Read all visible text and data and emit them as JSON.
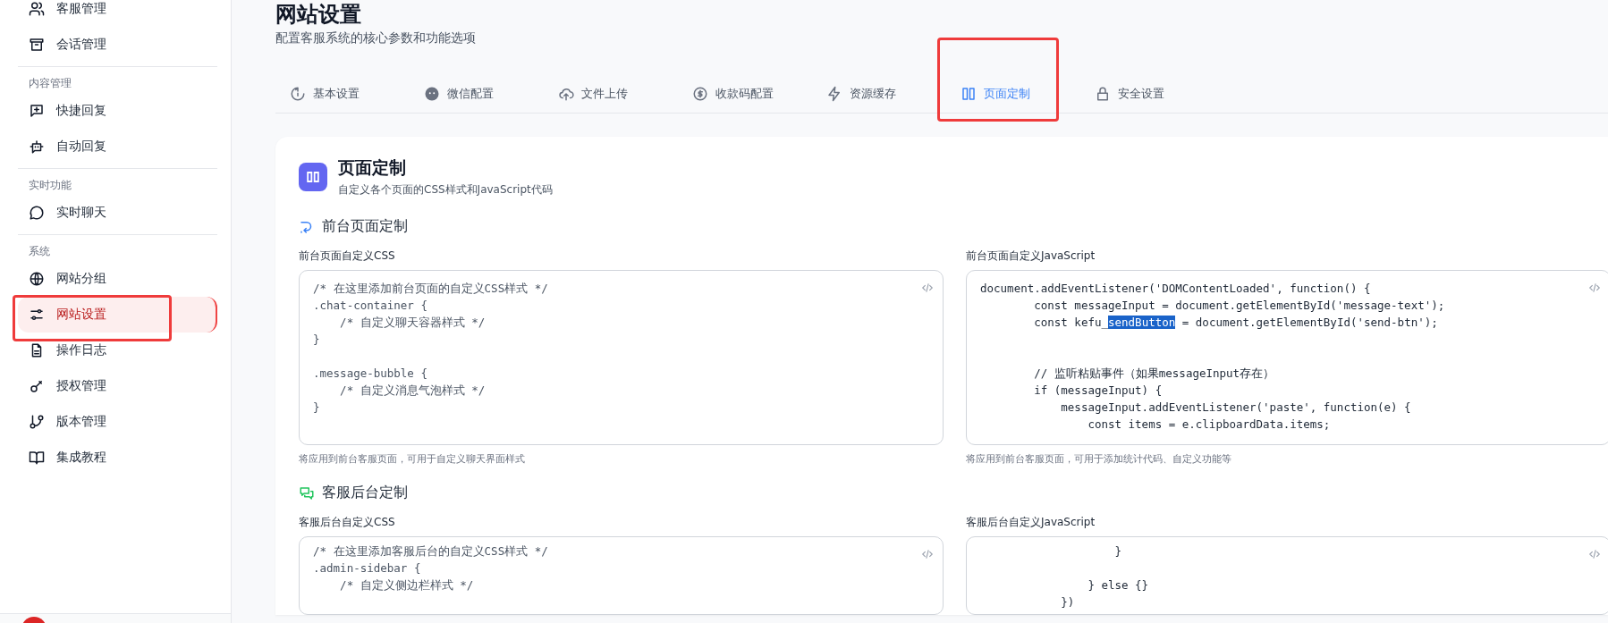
{
  "sidebar": {
    "groups": [
      {
        "items": [
          {
            "label": "客服管理",
            "selected": false
          },
          {
            "label": "会话管理",
            "selected": false
          }
        ]
      },
      {
        "heading": "内容管理",
        "items": [
          {
            "label": "快捷回复",
            "selected": false
          },
          {
            "label": "自动回复",
            "selected": false
          }
        ]
      },
      {
        "heading": "实时功能",
        "items": [
          {
            "label": "实时聊天",
            "selected": false
          }
        ]
      },
      {
        "heading": "系统",
        "items": [
          {
            "label": "网站分组",
            "selected": false
          },
          {
            "label": "网站设置",
            "selected": true
          },
          {
            "label": "操作日志",
            "selected": false
          },
          {
            "label": "授权管理",
            "selected": false
          },
          {
            "label": "版本管理",
            "selected": false
          },
          {
            "label": "集成教程",
            "selected": false
          }
        ]
      }
    ]
  },
  "page": {
    "title": "网站设置",
    "subtitle": "配置客服系统的核心参数和功能选项"
  },
  "tabs": [
    {
      "label": "基本设置",
      "selected": false
    },
    {
      "label": "微信配置",
      "selected": false
    },
    {
      "label": "文件上传",
      "selected": false
    },
    {
      "label": "收款码配置",
      "selected": false
    },
    {
      "label": "资源缓存",
      "selected": false
    },
    {
      "label": "页面定制",
      "selected": true
    },
    {
      "label": "安全设置",
      "selected": false
    }
  ],
  "card": {
    "title": "页面定制",
    "subtitle": "自定义各个页面的CSS样式和JavaScript代码",
    "sections": [
      {
        "heading": "前台页面定制",
        "editors": [
          {
            "label": "前台页面自定义CSS",
            "code": [
              {
                "text": "/* 在这里添加前台页面的自定义CSS样式 */\n.chat-container {\n    /* 自定义聊天容器样式 */\n}\n\n.message-bubble {\n    /* 自定义消息气泡样式 */\n}",
                "selected": false
              }
            ],
            "hint": "将应用到前台客服页面，可用于自定义聊天界面样式"
          },
          {
            "label": "前台页面自定义JavaScript",
            "code": [
              {
                "text": "document.addEventListener('DOMContentLoaded', function() {\n        const messageInput = document.getElementById('message-text');\n        const kefu_",
                "selected": false
              },
              {
                "text": "sendButton",
                "selected": true
              },
              {
                "text": " = document.getElementById('send-btn');\n\n\n        // 监听粘贴事件（如果messageInput存在）\n        if (messageInput) {\n            messageInput.addEventListener('paste', function(e) {\n                const items = e.clipboardData.items;",
                "selected": false
              }
            ],
            "hint": "将应用到前台客服页面，可用于添加统计代码、自定义功能等"
          }
        ]
      },
      {
        "heading": "客服后台定制",
        "editors": [
          {
            "label": "客服后台自定义CSS",
            "code": [
              {
                "text": "/* 在这里添加客服后台的自定义CSS样式 */\n.admin-sidebar {\n    /* 自定义侧边栏样式 */",
                "selected": false
              }
            ]
          },
          {
            "label": "客服后台自定义JavaScript",
            "code": [
              {
                "text": "                    }\n\n                } else {}\n            })",
                "selected": false
              }
            ]
          }
        ]
      }
    ]
  }
}
